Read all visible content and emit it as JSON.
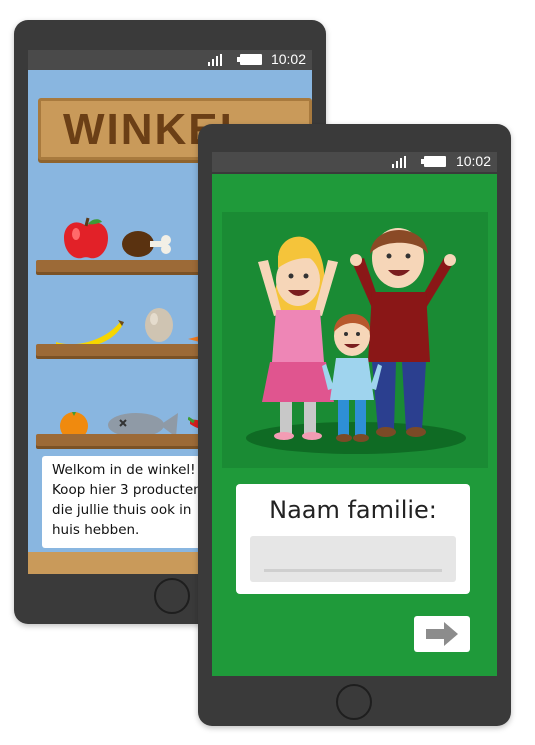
{
  "back_phone": {
    "status_time": "10:02",
    "sign_text": "WINKEL",
    "welcome_lines": [
      "Welkom in de winkel!",
      "Koop hier 3 producten",
      "die jullie thuis ook in",
      "huis hebben."
    ],
    "icons": [
      "signal-icon",
      "battery-icon",
      "apple-icon",
      "drumstick-icon",
      "banana-icon",
      "egg-icon",
      "carrot-icon",
      "orange-icon",
      "fish-icon",
      "chili-icon"
    ]
  },
  "front_phone": {
    "status_time": "10:02",
    "name_label": "Naam familie:",
    "name_input_value": "",
    "icons": [
      "signal-icon",
      "battery-icon",
      "family-illustration",
      "arrow-right-icon"
    ]
  },
  "colors": {
    "back_screen": "#89b6e0",
    "front_screen": "#1f9a3a",
    "phone_body": "#3a3a3a",
    "wood": "#c99a5a"
  }
}
